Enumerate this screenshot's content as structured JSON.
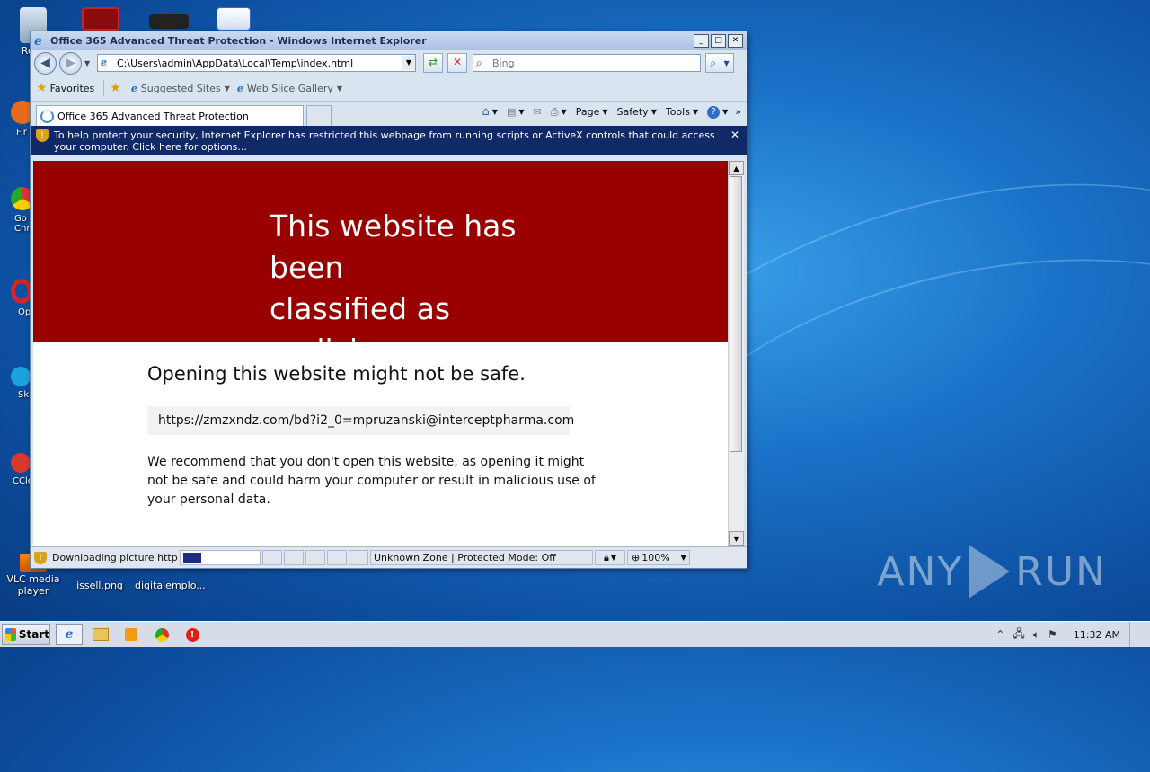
{
  "desktop": {
    "icons": [
      {
        "label": "Recy"
      },
      {
        "label": "VLC media player"
      },
      {
        "label": "issell.png"
      },
      {
        "label": "digitalemplo..."
      }
    ],
    "side_labels": [
      "Fir",
      "Go Chr",
      "Op",
      "Sk",
      "CCle"
    ],
    "watermark": "ANY RUN"
  },
  "window": {
    "title": "Office 365 Advanced Threat Protection - Windows Internet Explorer",
    "address": "C:\\Users\\admin\\AppData\\Local\\Temp\\index.html",
    "search_placeholder": "Bing",
    "favorites_label": "Favorites",
    "suggested_sites": "Suggested Sites",
    "web_slice_gallery": "Web Slice Gallery",
    "tab_title": "Office 365 Advanced Threat Protection",
    "commands": {
      "page": "Page",
      "safety": "Safety",
      "tools": "Tools"
    },
    "info_bar": "To help protect your security, Internet Explorer has restricted this webpage from running scripts or ActiveX controls that could access your computer. Click here for options..."
  },
  "page": {
    "banner_line1": "This website has been",
    "banner_line2": "classified as malicious.",
    "heading": "Opening this website might not be safe.",
    "url": "https://zmzxndz.com/bd?i2_0=mpruzanski@interceptpharma.com",
    "recommendation": "We recommend that you don't open this website, as opening it might not be safe and could harm your computer or result in malicious use of your personal data.",
    "banner_color": "#990000"
  },
  "status": {
    "text": "Downloading picture https://n",
    "zone": "Unknown Zone | Protected Mode: Off",
    "zoom": "100%"
  },
  "taskbar": {
    "start": "Start",
    "clock": "11:32 AM"
  }
}
